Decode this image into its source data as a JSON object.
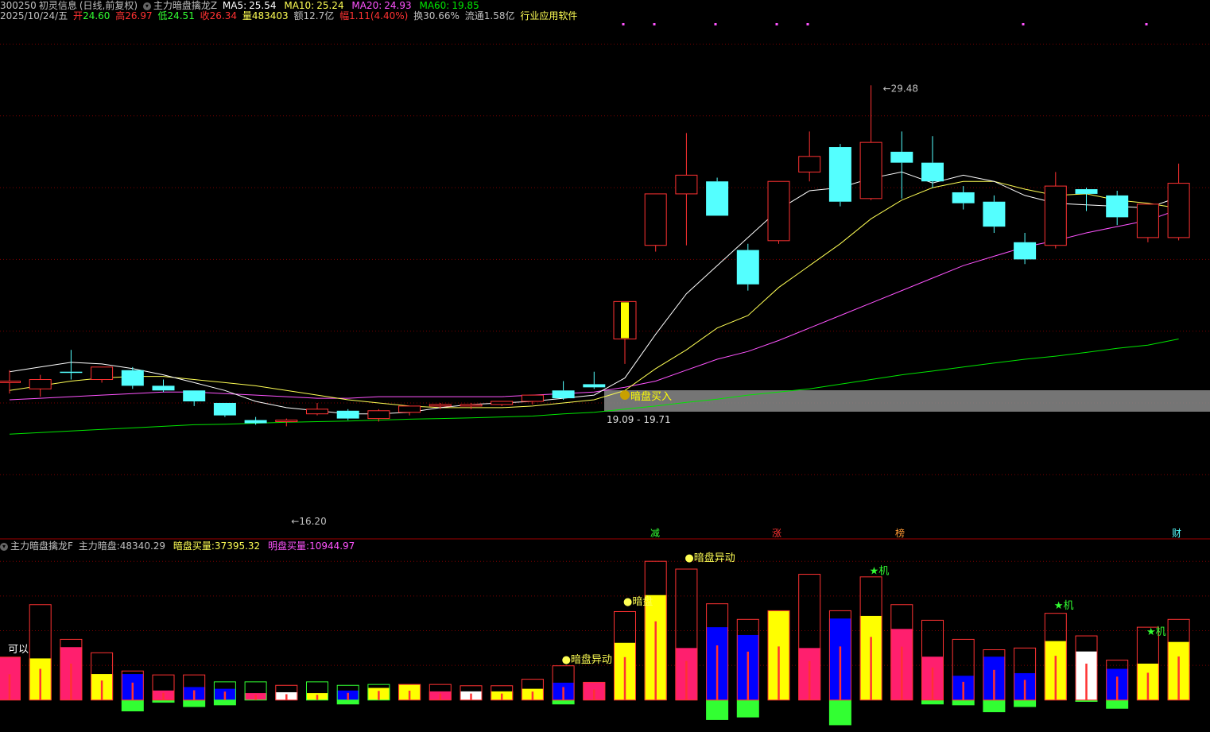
{
  "header": {
    "code": "300250",
    "name": "初灵信息",
    "mode": "(日线,前复权)",
    "indicator": "主力暗盘擒龙Z",
    "ma5_label": "MA5:",
    "ma5": "25.54",
    "ma10_label": "MA10:",
    "ma10": "25.24",
    "ma20_label": "MA20:",
    "ma20": "24.93",
    "ma60_label": "MA60:",
    "ma60": "19.85",
    "date": "2025/10/24/五",
    "open_label": "开",
    "open": "24.60",
    "high_label": "高",
    "high": "26.97",
    "low_label": "低",
    "low": "24.51",
    "close_label": "收",
    "close": "26.34",
    "vol_label": "量",
    "vol": "483403",
    "amt_label": "额",
    "amt": "12.7亿",
    "chg_label": "幅",
    "chg": "1.11(4.40%)",
    "turn_label": "换",
    "turn": "30.66%",
    "float_label": "流通",
    "float": "1.58亿",
    "industry": "行业应用软件"
  },
  "lower_header": {
    "indicator": "主力暗盘擒龙F",
    "main_label": "主力暗盘:",
    "main": "48340.29",
    "dark_label": "暗盘买量:",
    "dark": "37395.32",
    "lit_label": "明盘买量:",
    "lit": "10944.97"
  },
  "colors": {
    "up": "#ff3232",
    "down": "#54ffff",
    "ma5": "#ffffff",
    "ma10": "#ffff54",
    "ma20": "#ff54ff",
    "ma60": "#00e600",
    "grid": "#7a0000",
    "yellow": "#ffff00",
    "pink": "#ff1f6e",
    "blue": "#0000ff",
    "green": "#32ff32"
  },
  "chart_data": {
    "type": "candlestick",
    "ylim": [
      15.3,
      31.5
    ],
    "candles": [
      {
        "o": 19.95,
        "h": 20.35,
        "l": 19.6,
        "c": 20.0
      },
      {
        "o": 19.75,
        "h": 20.2,
        "l": 19.5,
        "c": 20.05
      },
      {
        "o": 20.3,
        "h": 21.0,
        "l": 20.05,
        "c": 20.28
      },
      {
        "o": 20.05,
        "h": 20.4,
        "l": 19.95,
        "c": 20.45
      },
      {
        "o": 20.35,
        "h": 20.45,
        "l": 19.75,
        "c": 19.85
      },
      {
        "o": 19.85,
        "h": 20.05,
        "l": 19.65,
        "c": 19.7
      },
      {
        "o": 19.7,
        "h": 19.7,
        "l": 19.2,
        "c": 19.35
      },
      {
        "o": 19.3,
        "h": 19.3,
        "l": 18.85,
        "c": 18.9
      },
      {
        "o": 18.75,
        "h": 18.85,
        "l": 18.6,
        "c": 18.65
      },
      {
        "o": 18.7,
        "h": 18.8,
        "l": 18.55,
        "c": 18.75
      },
      {
        "o": 18.95,
        "h": 19.3,
        "l": 18.9,
        "c": 19.1
      },
      {
        "o": 19.05,
        "h": 19.1,
        "l": 18.75,
        "c": 18.8
      },
      {
        "o": 18.8,
        "h": 19.1,
        "l": 18.7,
        "c": 19.05
      },
      {
        "o": 19.0,
        "h": 19.2,
        "l": 18.9,
        "c": 19.2
      },
      {
        "o": 19.2,
        "h": 19.3,
        "l": 19.1,
        "c": 19.25
      },
      {
        "o": 19.2,
        "h": 19.3,
        "l": 19.1,
        "c": 19.25
      },
      {
        "o": 19.25,
        "h": 19.35,
        "l": 19.2,
        "c": 19.35
      },
      {
        "o": 19.35,
        "h": 19.55,
        "l": 19.25,
        "c": 19.55
      },
      {
        "o": 19.7,
        "h": 20.0,
        "l": 19.4,
        "c": 19.45
      },
      {
        "o": 19.9,
        "h": 20.3,
        "l": 19.75,
        "c": 19.8
      },
      {
        "o": 21.35,
        "h": 21.35,
        "l": 20.55,
        "c": 22.55
      },
      {
        "o": 24.35,
        "h": 26.0,
        "l": 24.15,
        "c": 26.0
      },
      {
        "o": 26.0,
        "h": 27.95,
        "l": 24.35,
        "c": 26.6
      },
      {
        "o": 26.4,
        "h": 26.52,
        "l": 25.3,
        "c": 25.3
      },
      {
        "o": 24.2,
        "h": 24.4,
        "l": 22.9,
        "c": 23.1
      },
      {
        "o": 24.5,
        "h": 26.4,
        "l": 24.4,
        "c": 26.4
      },
      {
        "o": 26.7,
        "h": 28.0,
        "l": 26.4,
        "c": 27.2
      },
      {
        "o": 27.5,
        "h": 27.6,
        "l": 25.6,
        "c": 25.75
      },
      {
        "o": 25.85,
        "h": 29.48,
        "l": 25.8,
        "c": 27.65
      },
      {
        "o": 27.35,
        "h": 28.0,
        "l": 25.85,
        "c": 27.0
      },
      {
        "o": 27.0,
        "h": 27.85,
        "l": 26.2,
        "c": 26.4
      },
      {
        "o": 26.05,
        "h": 26.25,
        "l": 25.5,
        "c": 25.7
      },
      {
        "o": 25.75,
        "h": 25.95,
        "l": 24.75,
        "c": 24.95
      },
      {
        "o": 24.45,
        "h": 24.75,
        "l": 23.75,
        "c": 23.9
      },
      {
        "o": 24.35,
        "h": 26.7,
        "l": 24.25,
        "c": 26.25
      },
      {
        "o": 26.15,
        "h": 26.2,
        "l": 25.45,
        "c": 26.0
      },
      {
        "o": 25.95,
        "h": 26.1,
        "l": 25.0,
        "c": 25.25
      },
      {
        "o": 24.6,
        "h": 25.67,
        "l": 24.45,
        "c": 25.67
      },
      {
        "o": 24.6,
        "h": 26.97,
        "l": 24.51,
        "c": 26.34
      }
    ],
    "ma5": [
      20.3,
      20.45,
      20.6,
      20.55,
      20.4,
      20.2,
      19.95,
      19.7,
      19.35,
      19.15,
      19.05,
      18.95,
      18.95,
      19.0,
      19.15,
      19.25,
      19.3,
      19.35,
      19.45,
      19.55,
      20.1,
      21.5,
      22.8,
      23.7,
      24.6,
      25.5,
      26.1,
      26.2,
      26.5,
      26.7,
      26.35,
      26.6,
      26.4,
      25.95,
      25.7,
      25.65,
      25.6,
      25.55,
      25.9
    ],
    "ma10": [
      19.7,
      19.85,
      20.0,
      20.1,
      20.15,
      20.15,
      20.05,
      19.95,
      19.85,
      19.7,
      19.55,
      19.4,
      19.3,
      19.2,
      19.15,
      19.15,
      19.15,
      19.2,
      19.3,
      19.4,
      19.7,
      20.4,
      21.0,
      21.7,
      22.1,
      23.0,
      23.7,
      24.4,
      25.2,
      25.8,
      26.2,
      26.4,
      26.4,
      26.15,
      25.95,
      26.0,
      25.8,
      25.7,
      25.54
    ],
    "ma20": [
      19.4,
      19.45,
      19.5,
      19.55,
      19.6,
      19.65,
      19.65,
      19.6,
      19.55,
      19.5,
      19.45,
      19.45,
      19.5,
      19.5,
      19.5,
      19.5,
      19.5,
      19.55,
      19.6,
      19.65,
      19.8,
      20.0,
      20.35,
      20.7,
      20.95,
      21.3,
      21.7,
      22.1,
      22.5,
      22.9,
      23.3,
      23.7,
      24.0,
      24.3,
      24.5,
      24.75,
      24.95,
      25.15,
      25.5
    ],
    "ma60": [
      18.3,
      18.35,
      18.4,
      18.45,
      18.5,
      18.55,
      18.6,
      18.62,
      18.65,
      18.68,
      18.7,
      18.72,
      18.75,
      18.78,
      18.8,
      18.82,
      18.85,
      18.88,
      18.95,
      19.0,
      19.1,
      19.2,
      19.32,
      19.42,
      19.55,
      19.65,
      19.75,
      19.9,
      20.05,
      20.2,
      20.32,
      20.45,
      20.58,
      20.7,
      20.8,
      20.92,
      21.05,
      21.15,
      21.35
    ],
    "annotations": {
      "peak_label": "29.48",
      "low_label": "16.20",
      "buy_label": "暗盘买入",
      "range_label": "19.09 - 19.71"
    },
    "markers": [
      "减",
      "涨",
      "榜",
      "财"
    ],
    "volume": {
      "ylim": [
        -3.5,
        17.3
      ],
      "bars": [
        {
          "k": "pink",
          "h": 4.95,
          "o": 4.95
        },
        {
          "k": "yellow",
          "h": 4.8,
          "o": 11.0
        },
        {
          "k": "pink",
          "h": 6.1,
          "o": 7.0
        },
        {
          "k": "yellow",
          "h": 3.0,
          "o": 5.45
        },
        {
          "k": "blue",
          "h": 3.0,
          "o": 3.35,
          "g": -1.3
        },
        {
          "k": "pink",
          "h": 1.1,
          "o": 2.9,
          "g": -0.3
        },
        {
          "k": "blue",
          "h": 1.5,
          "o": 2.9,
          "g": -0.8
        },
        {
          "k": "blue",
          "h": 1.3,
          "o": 2.1,
          "g": -0.6,
          "b": "green"
        },
        {
          "k": "pink",
          "h": 0.8,
          "o": 2.1,
          "b": "green"
        },
        {
          "k": "white",
          "h": 0.9,
          "o": 1.7
        },
        {
          "k": "yellow",
          "h": 0.8,
          "o": 2.1,
          "b": "green"
        },
        {
          "k": "blue",
          "h": 1.1,
          "o": 1.7,
          "g": -0.5,
          "b": "green"
        },
        {
          "k": "yellow",
          "h": 1.4,
          "o": 1.8,
          "b": "green"
        },
        {
          "k": "yellow",
          "h": 1.8,
          "o": 1.8
        },
        {
          "k": "pink",
          "h": 1.0,
          "o": 1.8
        },
        {
          "k": "white",
          "h": 1.0,
          "o": 1.65
        },
        {
          "k": "yellow",
          "h": 1.0,
          "o": 1.65
        },
        {
          "k": "yellow",
          "h": 1.3,
          "o": 2.4
        },
        {
          "k": "blue",
          "h": 2.0,
          "o": 3.95,
          "g": -0.5
        },
        {
          "k": "pink",
          "h": 2.05,
          "o": 2.05
        },
        {
          "k": "yellow",
          "h": 6.6,
          "o": 10.2
        },
        {
          "k": "yellow",
          "h": 12.1,
          "o": 16.0
        },
        {
          "k": "pink",
          "h": 6.0,
          "o": 15.1
        },
        {
          "k": "blue",
          "h": 8.4,
          "o": 11.1,
          "g": -2.3
        },
        {
          "k": "blue",
          "h": 7.5,
          "o": 9.3,
          "g": -2.0
        },
        {
          "k": "yellow",
          "h": 10.3,
          "o": 10.3
        },
        {
          "k": "pink",
          "h": 6.0,
          "o": 14.5
        },
        {
          "k": "blue",
          "h": 9.4,
          "o": 10.3,
          "g": -2.9
        },
        {
          "k": "yellow",
          "h": 9.7,
          "o": 14.2
        },
        {
          "k": "pink",
          "h": 8.2,
          "o": 11.0
        },
        {
          "k": "pink",
          "h": 5.0,
          "o": 9.2,
          "g": -0.5
        },
        {
          "k": "blue",
          "h": 2.8,
          "o": 7.0,
          "g": -0.6
        },
        {
          "k": "blue",
          "h": 5.0,
          "o": 5.8,
          "g": -1.4
        },
        {
          "k": "blue",
          "h": 3.1,
          "o": 6.0,
          "g": -0.8
        },
        {
          "k": "yellow",
          "h": 6.8,
          "o": 10.0
        },
        {
          "k": "white",
          "h": 5.6,
          "o": 7.4,
          "g": -0.2
        },
        {
          "k": "blue",
          "h": 3.6,
          "o": 4.6,
          "g": -1.0
        },
        {
          "k": "yellow",
          "h": 4.2,
          "o": 8.4
        },
        {
          "k": "yellow",
          "h": 6.7,
          "o": 9.3
        }
      ],
      "labels": [
        {
          "t": "可以",
          "i": 0,
          "v": 5.5,
          "c": "#ffffff"
        },
        {
          "t": "●暗盘异动",
          "i": 18,
          "v": 4.3,
          "c": "#ffff54"
        },
        {
          "t": "●暗盘",
          "i": 20,
          "v": 11.0,
          "c": "#ffff54"
        },
        {
          "t": "●暗盘异动",
          "i": 22,
          "v": 16.0,
          "c": "#ffff54"
        },
        {
          "t": "★机",
          "i": 28,
          "v": 14.5,
          "c": "#32ff32"
        },
        {
          "t": "★机",
          "i": 34,
          "v": 10.5,
          "c": "#32ff32"
        },
        {
          "t": "★机",
          "i": 37,
          "v": 7.5,
          "c": "#32ff32"
        }
      ]
    }
  }
}
